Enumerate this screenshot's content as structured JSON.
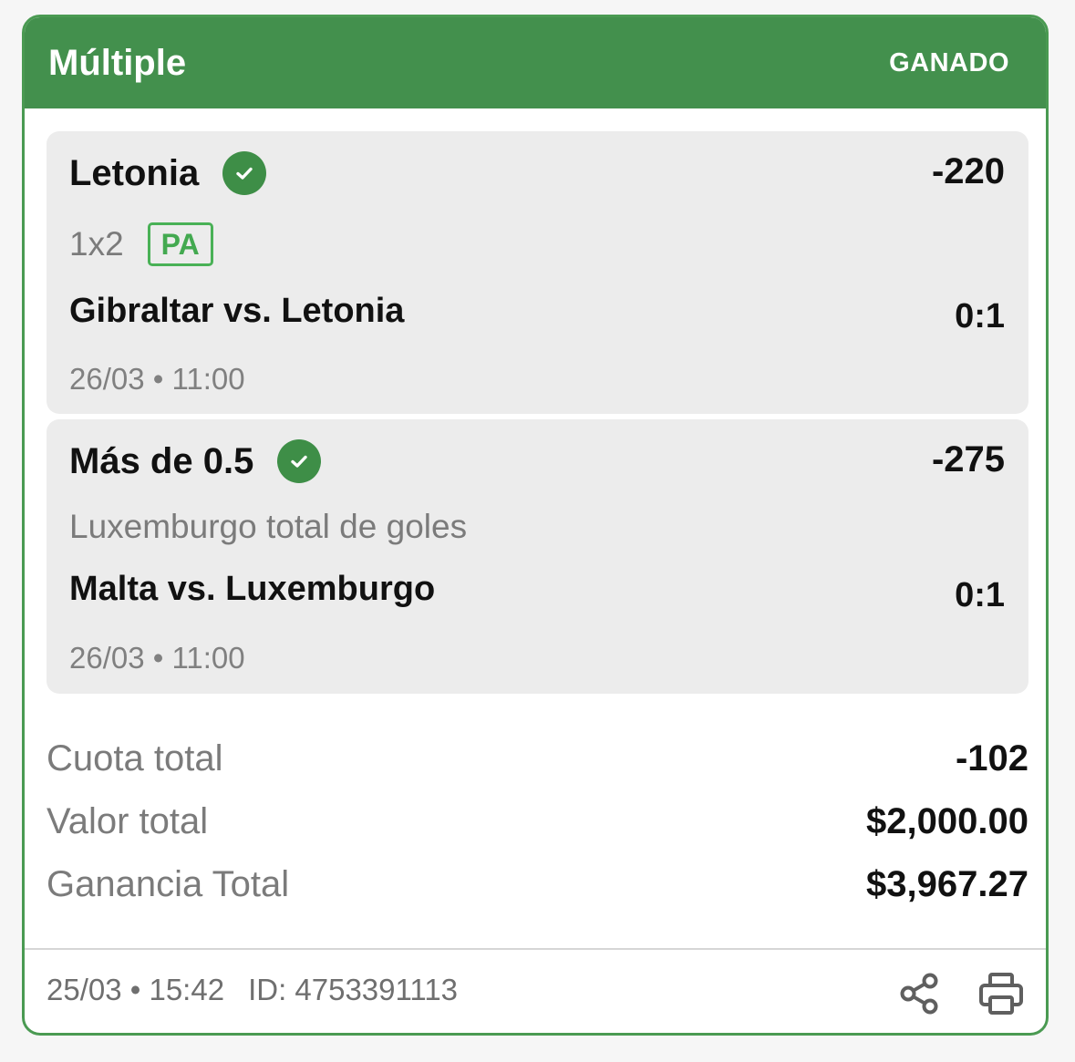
{
  "header": {
    "title": "Múltiple",
    "status": "GANADO"
  },
  "selections": [
    {
      "pick": "Letonia",
      "odds": "-220",
      "market": "1x2",
      "badge": "PA",
      "event": "Gibraltar vs. Letonia",
      "score": "0:1",
      "datetime": "26/03 • 11:00",
      "icon": "check-circle-icon"
    },
    {
      "pick": "Más de 0.5",
      "odds": "-275",
      "market": "Luxemburgo total de goles",
      "event": "Malta vs. Luxemburgo",
      "score": "0:1",
      "datetime": "26/03 • 11:00",
      "icon": "check-circle-icon"
    }
  ],
  "summary": {
    "total_odds_label": "Cuota total",
    "total_odds_value": "-102",
    "total_stake_label": "Valor total",
    "total_stake_value": "$2,000.00",
    "total_win_label": "Ganancia Total",
    "total_win_value": "$3,967.27"
  },
  "footer": {
    "datetime": "25/03 • 15:42",
    "id": "ID: 4753391113",
    "icons": [
      "share-icon",
      "print-icon"
    ]
  },
  "colors": {
    "header_green": "#43904d",
    "check_green": "#3e8e47",
    "badge_green": "#49b156",
    "card_border": "#4a9a52"
  }
}
